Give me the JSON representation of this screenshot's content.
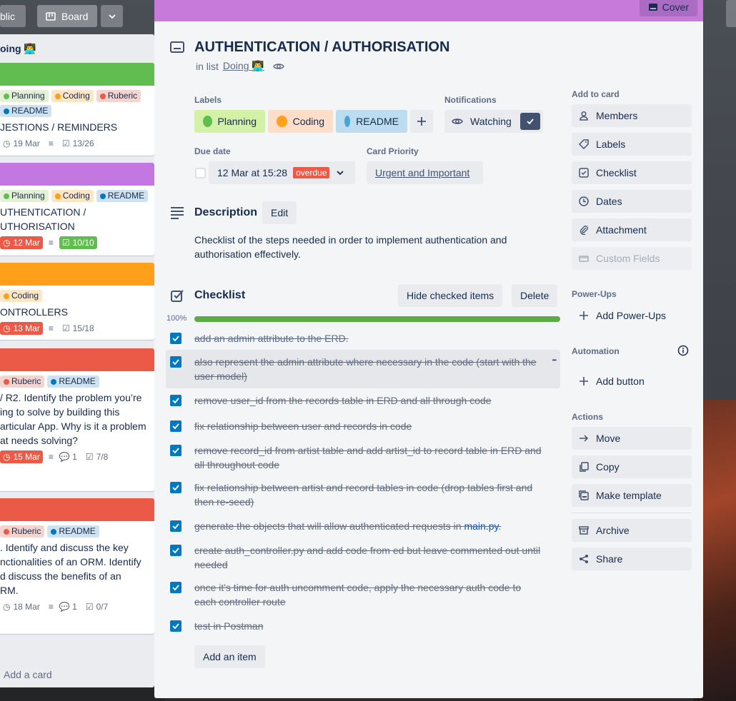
{
  "board": {
    "visibility_btn": "blic",
    "board_btn": "Board",
    "list_title": "oing 👨‍💻",
    "add_card": "Add a card",
    "cards": [
      {
        "cover": "#61bd4f",
        "labels": [
          {
            "t": "Planning",
            "c": "#61bd4f",
            "bg": "#e4f0d6"
          },
          {
            "t": "Coding",
            "c": "#ff9f1a",
            "bg": "#fce6c6"
          },
          {
            "t": "Ruberic",
            "c": "#eb5a46",
            "bg": "#f5d3ce"
          },
          {
            "t": "README",
            "c": "#0079bf",
            "bg": "#cfe2f2"
          }
        ],
        "title": "JESTIONS / REMINDERS",
        "date": "19 Mar",
        "checklist": "13/26"
      },
      {
        "cover": "#c377e0",
        "labels": [
          {
            "t": "Planning",
            "c": "#61bd4f",
            "bg": "#e4f0d6"
          },
          {
            "t": "Coding",
            "c": "#ff9f1a",
            "bg": "#fce6c6"
          },
          {
            "t": "README",
            "c": "#0079bf",
            "bg": "#cfe2f2"
          }
        ],
        "title": "UTHENTICATION /\nUTHORISATION",
        "date": "12 Mar",
        "checklist": "10/10"
      },
      {
        "cover": "#ff9f1a",
        "labels": [
          {
            "t": "Coding",
            "c": "#ff9f1a",
            "bg": "#fce6c6"
          }
        ],
        "title": "ONTROLLERS",
        "date": "13 Mar",
        "checklist": "15/18"
      },
      {
        "cover": "#eb5a46",
        "labels": [
          {
            "t": "Ruberic",
            "c": "#eb5a46",
            "bg": "#f5d3ce"
          },
          {
            "t": "README",
            "c": "#0079bf",
            "bg": "#cfe2f2"
          }
        ],
        "title": "/ R2. Identify the problem you’re\ning to solve by building this\narticular App. Why is it a problem\nat needs solving?",
        "date": "15 Mar",
        "comments": "1",
        "checklist": "7/8"
      },
      {
        "cover": "#eb5a46",
        "labels": [
          {
            "t": "Ruberic",
            "c": "#eb5a46",
            "bg": "#f5d3ce"
          },
          {
            "t": "README",
            "c": "#0079bf",
            "bg": "#cfe2f2"
          }
        ],
        "title": ". Identify and discuss the key\nnctionalities of an ORM. Identify\nd discuss the benefits of an\nRM.",
        "date": "18 Mar",
        "comments": "1",
        "checklist": "0/7"
      }
    ]
  },
  "card": {
    "cover_btn": "Cover",
    "title": "AUTHENTICATION / AUTHORISATION",
    "in_list_prefix": "in list",
    "list_name": "Doing 👨‍💻",
    "labels_heading": "Labels",
    "labels": [
      {
        "text": "Planning",
        "dot": "#61bd4f",
        "bg": "#d3f1a7"
      },
      {
        "text": "Coding",
        "dot": "#ff9f1a",
        "bg": "#fedec8"
      },
      {
        "text": "README",
        "dot": "#4ea1d3",
        "bg": "#bcdcf0"
      }
    ],
    "notifications_heading": "Notifications",
    "watching_label": "Watching",
    "due_heading": "Due date",
    "due_value": "12 Mar at 15:28",
    "overdue_badge": "overdue",
    "priority_heading": "Card Priority",
    "priority_value": "Urgent and Important",
    "description_heading": "Description",
    "edit_label": "Edit",
    "description_text": "Checklist of the steps needed in order to implement authentication and authorisation effectively.",
    "checklist_heading": "Checklist",
    "hide_checked": "Hide checked items",
    "delete_label": "Delete",
    "progress_label": "100%",
    "progress": 1.0,
    "items": [
      {
        "text": "add an admin attribute to the ERD."
      },
      {
        "text": "also represent the admin attribute where necessary in the code (start with the user model)"
      },
      {
        "text": "remove user_id from the records table in ERD and all through code"
      },
      {
        "text": "fix relationship between user and records in code"
      },
      {
        "text": "remove record_id from artist table and add artist_id to record table in ERD and all throughout code"
      },
      {
        "text": "fix relationship between artist and record tables in code (drop tables first and then re-seed)"
      },
      {
        "text": "generate the objects that will allow authenticated requests in ",
        "link": "main.py",
        "suffix": "."
      },
      {
        "text": "create auth_controller.py and add code from ed but leave commented out until needed"
      },
      {
        "text": "once it's time for auth uncomment code, apply the necessary auth code to each controller route"
      },
      {
        "text": "test in Postman"
      }
    ],
    "add_item": "Add an item"
  },
  "sidebar": {
    "add_to_card": "Add to card",
    "members": "Members",
    "labels": "Labels",
    "checklist": "Checklist",
    "dates": "Dates",
    "attachment": "Attachment",
    "custom_fields": "Custom Fields",
    "power_ups_heading": "Power-Ups",
    "add_power_ups": "Add Power-Ups",
    "automation_heading": "Automation",
    "add_button": "Add button",
    "actions_heading": "Actions",
    "move": "Move",
    "copy": "Copy",
    "make_template": "Make template",
    "archive": "Archive",
    "share": "Share"
  },
  "colors": {
    "accent": "#0079bf",
    "cover": "#c77ad9",
    "progress": "#5aac44",
    "overdue": "#eb5a46"
  }
}
